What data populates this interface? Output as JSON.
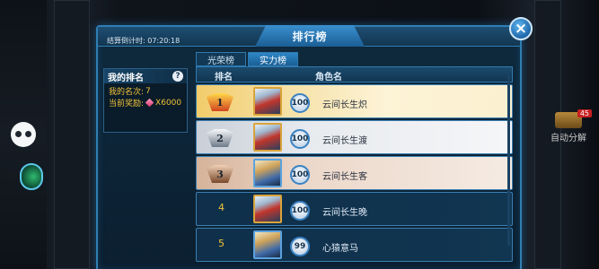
{
  "panel": {
    "title": "排行榜",
    "countdown_label": "结算倒计时:",
    "countdown_value": "07:20:18"
  },
  "my_rank": {
    "title": "我的排名",
    "help": "?",
    "rank_label": "我的名次:",
    "rank_value": "7",
    "reward_label": "当前奖励:",
    "reward_value": "X6000"
  },
  "tabs": [
    {
      "label": "光荣榜",
      "active": false
    },
    {
      "label": "实力榜",
      "active": true
    }
  ],
  "list_header": {
    "rank": "排名",
    "name": "角色名"
  },
  "rows": [
    {
      "rank": "1",
      "medal": "gold",
      "level": "100",
      "name": "云间长生炽"
    },
    {
      "rank": "2",
      "medal": "silver",
      "level": "100",
      "name": "云间长生渡"
    },
    {
      "rank": "3",
      "medal": "bronze",
      "level": "100",
      "name": "云间长生客"
    },
    {
      "rank": "4",
      "medal": "none",
      "level": "100",
      "name": "云间长生晚"
    },
    {
      "rank": "5",
      "medal": "none",
      "level": "99",
      "name": "心猿意马"
    }
  ],
  "side": {
    "auto_label": "自动分解",
    "auto_badge": "45"
  },
  "close_icon": "×"
}
